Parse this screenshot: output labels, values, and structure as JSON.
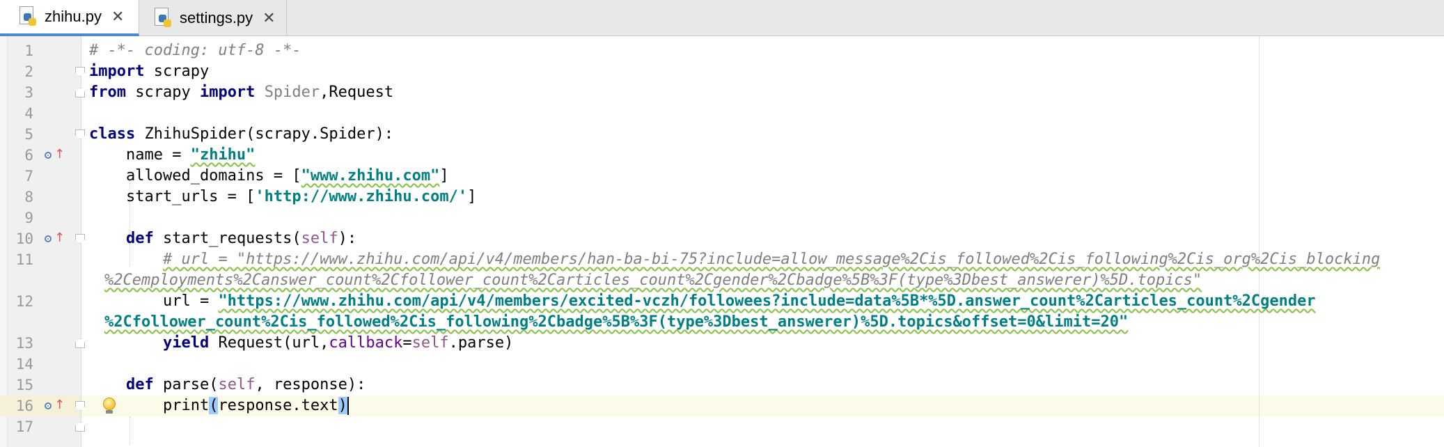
{
  "tabs": [
    {
      "label": "zhihu.py",
      "close": "✕",
      "active": true,
      "icon": "python-file-icon"
    },
    {
      "label": "settings.py",
      "close": "✕",
      "active": false,
      "icon": "python-file-icon"
    }
  ],
  "editor": {
    "line_numbers": [
      "1",
      "2",
      "3",
      "4",
      "5",
      "6",
      "7",
      "8",
      "9",
      "10",
      "11",
      "12",
      "13",
      "14",
      "15",
      "16",
      "17"
    ],
    "lines": {
      "l1": "# -*- coding: utf-8 -*-",
      "l2_kw": "import",
      "l2_rest": " scrapy",
      "l3_kw1": "from",
      "l3_mid": " scrapy ",
      "l3_kw2": "import",
      "l3_sp": " ",
      "l3_spider": "Spider",
      "l3_rest": ",Request",
      "l5_kw": "class",
      "l5_rest": " ZhihuSpider(scrapy.Spider):",
      "l6_pre": "    name = ",
      "l6_str": "\"zhihu\"",
      "l7_pre": "    allowed_domains = [",
      "l7_str": "\"www.zhihu.com\"",
      "l7_post": "]",
      "l8_pre": "    start_urls = [",
      "l8_str": "'http://www.zhihu.com/'",
      "l8_post": "]",
      "l10_pre": "    ",
      "l10_kw": "def",
      "l10_mid": " start_requests(",
      "l10_self": "self",
      "l10_post": "):",
      "l11_pre": "        ",
      "l11_a": "# url = \"https://www.zhihu.com/api/v4/members/han-ba-bi-75?include=allow_message%2Cis_followed%2Cis_following%2Cis_org%2Cis_blocking",
      "l11_b": "%2Cemployments%2Canswer_count%2Cfollower_count%2Carticles_count%2Cgender%2Cbadge%5B%3F(type%3Dbest_answerer)%5D.topics\"",
      "l12_pre": "        url = ",
      "l12_a": "\"https://www.zhihu.com/api/v4/members/excited-vczh/followees?include=data%5B*%5D.answer_count%2Carticles_count%2Cgender",
      "l12_b": "%2Cfollower_count%2Cis_followed%2Cis_following%2Cbadge%5B%3F(type%3Dbest_answerer)%5D.topics&offset=0&limit=20\"",
      "l13_pre": "        ",
      "l13_kw": "yield",
      "l13_mid": " Request(url,",
      "l13_kwarg": "callback",
      "l13_eq": "=",
      "l13_self": "self",
      "l13_post": ".parse)",
      "l15_pre": "    ",
      "l15_kw": "def",
      "l15_mid": " parse(",
      "l15_self": "self",
      "l15_post": ", response):",
      "l16_pre": "        print",
      "l16_open": "(",
      "l16_mid": "response.text",
      "l16_close": ")"
    }
  }
}
